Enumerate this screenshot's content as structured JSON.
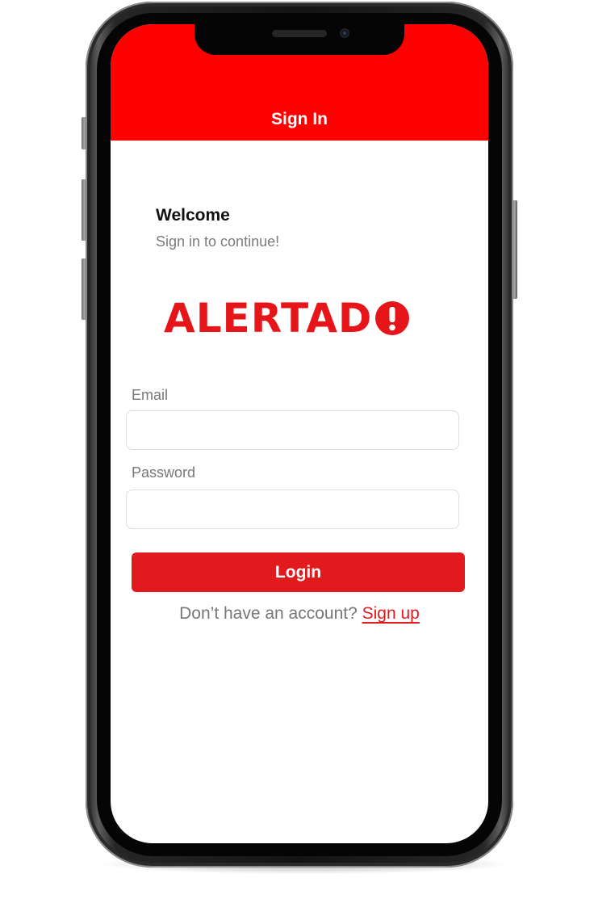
{
  "header": {
    "title": "Sign In"
  },
  "intro": {
    "welcome": "Welcome",
    "subtitle": "Sign in to continue!"
  },
  "logo": {
    "text": "ALERTAD",
    "icon": "alert-exclamation-icon",
    "color": "#e61519"
  },
  "form": {
    "email_label": "Email",
    "email_value": "",
    "password_label": "Password",
    "password_value": "",
    "login_label": "Login"
  },
  "footer": {
    "prompt": "Don’t have an account?",
    "signup_label": "Sign up"
  },
  "colors": {
    "header": "#fe0000",
    "accent": "#e11b1d",
    "muted_text": "#777777"
  }
}
